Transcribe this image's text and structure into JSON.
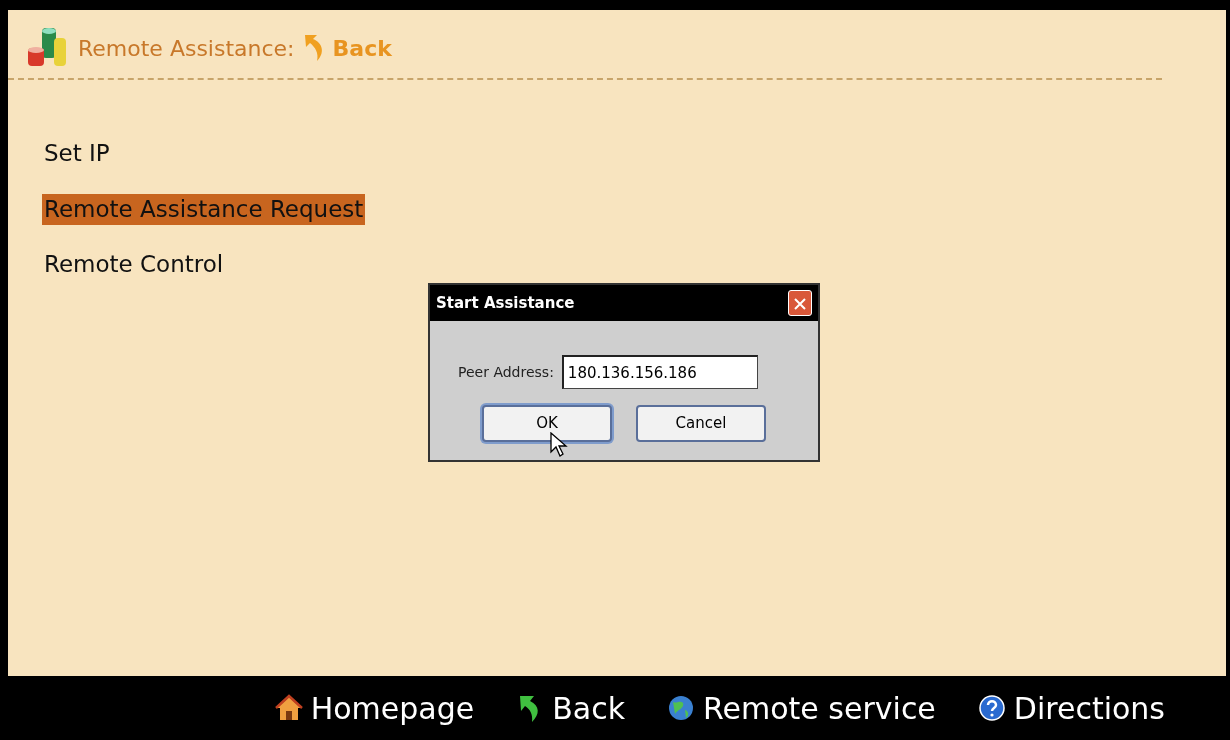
{
  "header": {
    "title": "Remote Assistance:",
    "back_link": "Back"
  },
  "menu": [
    {
      "label": "Set IP",
      "selected": false
    },
    {
      "label": "Remote Assistance Request",
      "selected": true
    },
    {
      "label": "Remote Control",
      "selected": false
    }
  ],
  "dialog": {
    "title": "Start Assistance",
    "field_label": "Peer Address:",
    "field_value": "180.136.156.186",
    "buttons": [
      {
        "label": "OK",
        "focused": true
      },
      {
        "label": "Cancel",
        "focused": false
      }
    ]
  },
  "bottom_bar": [
    {
      "label": "Homepage",
      "kind": "home"
    },
    {
      "label": "Back",
      "kind": "back"
    },
    {
      "label": "Remote service",
      "kind": "globe"
    },
    {
      "label": "Directions",
      "kind": "help"
    }
  ]
}
